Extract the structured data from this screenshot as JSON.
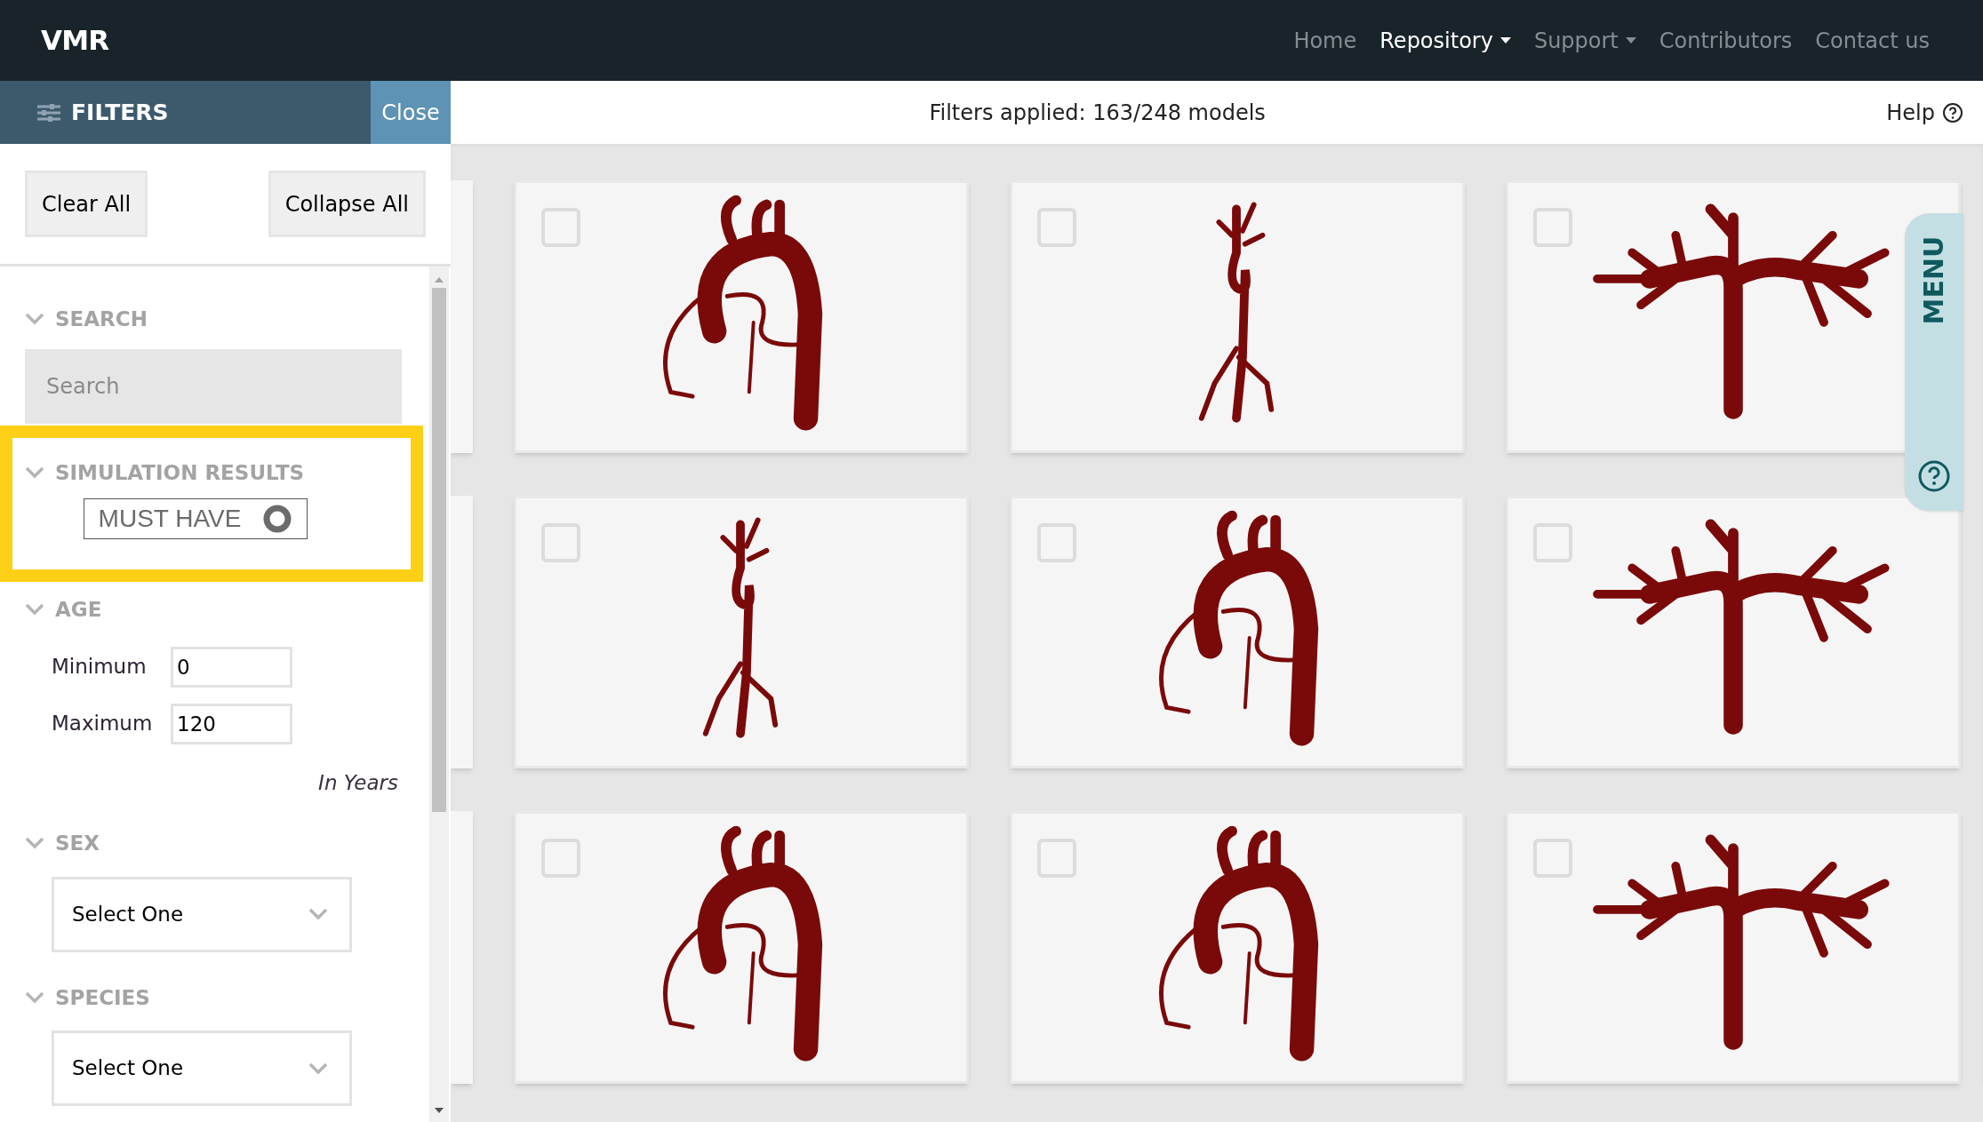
{
  "navbar": {
    "logo": "VMR",
    "links": [
      {
        "label": "Home",
        "selected": false,
        "dropdown": false
      },
      {
        "label": "Repository",
        "selected": true,
        "dropdown": true
      },
      {
        "label": "Support",
        "selected": false,
        "dropdown": true
      },
      {
        "label": "Contributors",
        "selected": false,
        "dropdown": false
      },
      {
        "label": "Contact us",
        "selected": false,
        "dropdown": false
      }
    ]
  },
  "filters_header": {
    "title": "FILTERS",
    "close": "Close"
  },
  "status": {
    "text": "Filters applied: 163/248 models",
    "help": "Help"
  },
  "buttons": [
    "Clear All",
    "Collapse All"
  ],
  "sections": [
    {
      "kind": "search",
      "title": "SEARCH",
      "placeholder": "Search",
      "highlighted": false
    },
    {
      "kind": "toggle",
      "title": "SIMULATION RESULTS",
      "label": "MUST HAVE",
      "on": false,
      "highlighted": true
    },
    {
      "kind": "range",
      "title": "AGE",
      "fields": [
        {
          "label": "Minimum",
          "value": "0"
        },
        {
          "label": "Maximum",
          "value": "120"
        }
      ],
      "note": "In Years",
      "highlighted": false
    },
    {
      "kind": "select",
      "title": "SEX",
      "value": "Select One",
      "highlighted": false
    },
    {
      "kind": "select",
      "title": "SPECIES",
      "value": "Select One",
      "highlighted": false
    }
  ],
  "models": [
    {
      "checked": false
    },
    {
      "checked": false
    },
    {
      "checked": false
    },
    {
      "checked": false
    },
    {
      "checked": false
    },
    {
      "checked": false
    },
    {
      "checked": false
    },
    {
      "checked": false
    },
    {
      "checked": false
    }
  ],
  "menu_tab": {
    "label": "MENU"
  }
}
